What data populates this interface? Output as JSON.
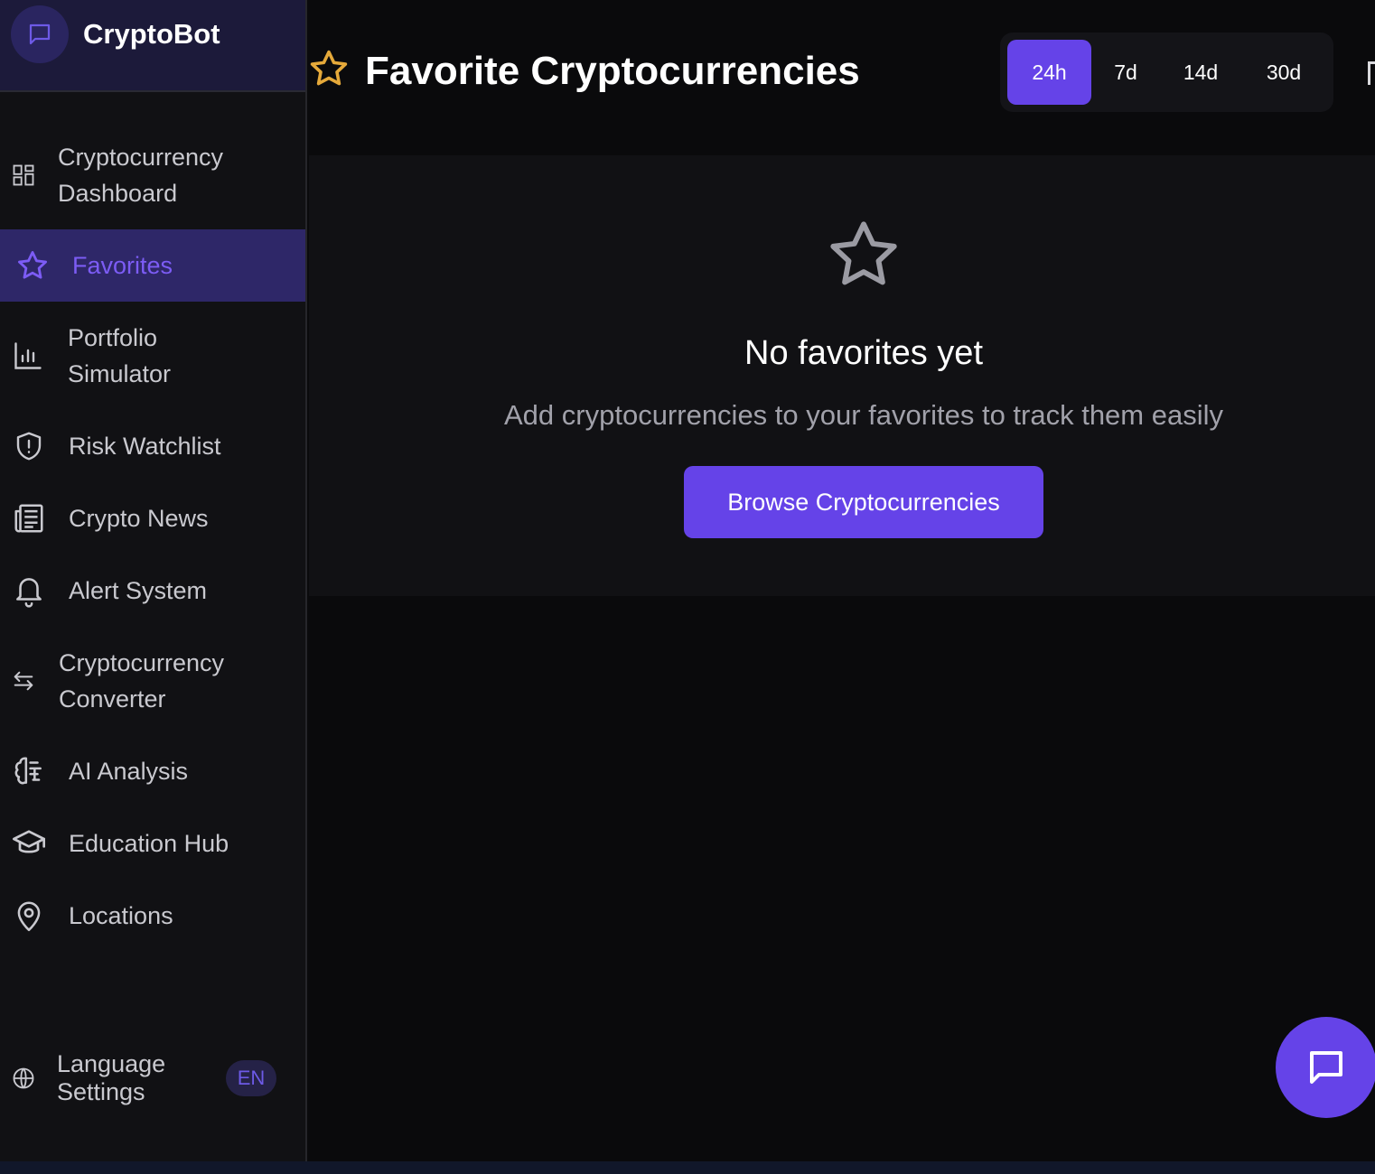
{
  "app": {
    "brand_name": "CryptoBot"
  },
  "sidebar": {
    "items": [
      {
        "line1": "Cryptocurrency",
        "line2": "Dashboard",
        "icon": "dashboard-grid-icon"
      },
      {
        "label": "Favorites",
        "icon": "star-icon",
        "active": true
      },
      {
        "line1": "Portfolio",
        "line2": "Simulator",
        "icon": "bar-chart-icon"
      },
      {
        "label": "Risk Watchlist",
        "icon": "shield-alert-icon"
      },
      {
        "label": "Crypto News",
        "icon": "newspaper-icon"
      },
      {
        "label": "Alert System",
        "icon": "bell-icon"
      },
      {
        "line1": "Cryptocurrency",
        "line2": "Converter",
        "icon": "swap-arrows-icon"
      },
      {
        "label": "AI Analysis",
        "icon": "brain-icon"
      },
      {
        "label": "Education Hub",
        "icon": "graduation-cap-icon"
      },
      {
        "label": "Locations",
        "icon": "map-pin-icon"
      }
    ],
    "language": {
      "line1": "Language",
      "line2": "Settings",
      "badge": "EN",
      "icon": "globe-icon"
    }
  },
  "header": {
    "title": "Favorite Cryptocurrencies",
    "periods": [
      "24h",
      "7d",
      "14d",
      "30d"
    ],
    "selected_period": "24h"
  },
  "empty_state": {
    "title": "No favorites yet",
    "subtitle": "Add cryptocurrencies to your favorites to track them easily",
    "button_label": "Browse Cryptocurrencies"
  },
  "colors": {
    "accent": "#6543e8",
    "title_star": "#e5a93a",
    "active_nav_bg": "#2e2768",
    "active_nav_text": "#7c5cf5"
  }
}
